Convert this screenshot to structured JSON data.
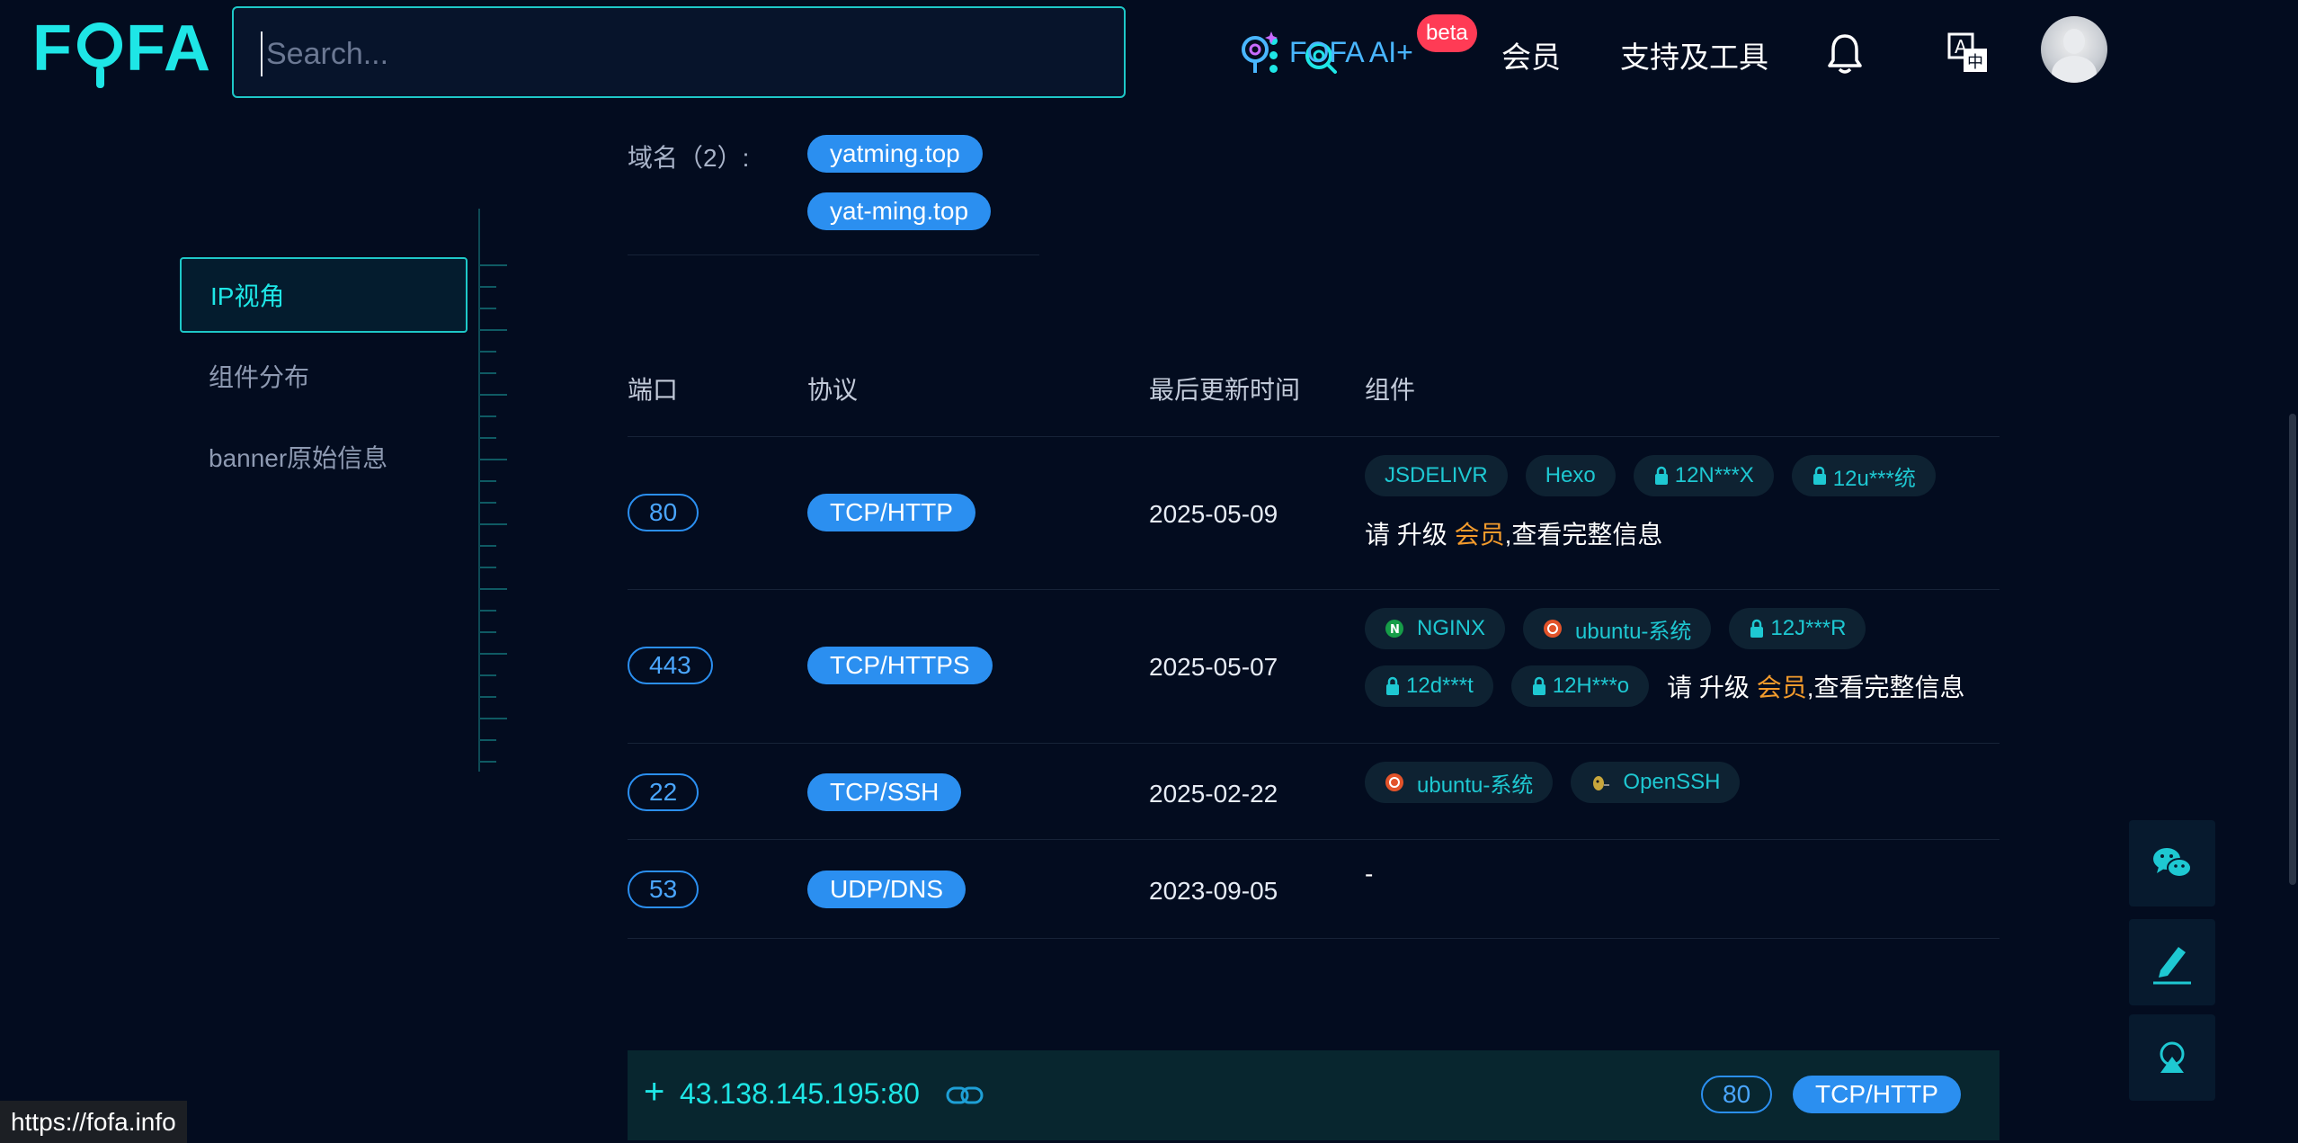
{
  "header": {
    "logo_text": "FOFA",
    "search_placeholder": "Search...",
    "ai_label": "FOFA AI+",
    "beta_label": "beta",
    "nav_member": "会员",
    "nav_tools": "支持及工具"
  },
  "sidebar": {
    "items": [
      {
        "label": "IP视角",
        "active": true
      },
      {
        "label": "组件分布",
        "active": false
      },
      {
        "label": "banner原始信息",
        "active": false
      }
    ]
  },
  "domains": {
    "label": "域名（2）:",
    "items": [
      "yatming.top",
      "yat-ming.top"
    ]
  },
  "table": {
    "headers": {
      "port": "端口",
      "protocol": "协议",
      "updated": "最后更新时间",
      "components": "组件"
    },
    "rows": [
      {
        "port": "80",
        "protocol": "TCP/HTTP",
        "updated": "2025-05-09",
        "components": [
          "JSDELIVR",
          "Hexo"
        ],
        "locked": [
          "12N***X",
          "12u***统"
        ],
        "upgrade": {
          "pre": "请 升级 ",
          "vip": "会员",
          "post": ",查看完整信息"
        }
      },
      {
        "port": "443",
        "protocol": "TCP/HTTPS",
        "updated": "2025-05-07",
        "components": [
          "NGINX",
          "ubuntu-系统"
        ],
        "locked": [
          "12J***R",
          "12d***t",
          "12H***o"
        ],
        "upgrade": {
          "pre": "请 升级 ",
          "vip": "会员",
          "post": ",查看完整信息"
        }
      },
      {
        "port": "22",
        "protocol": "TCP/SSH",
        "updated": "2025-02-22",
        "components": [
          "ubuntu-系统",
          "OpenSSH"
        ]
      },
      {
        "port": "53",
        "protocol": "UDP/DNS",
        "updated": "2023-09-05",
        "empty_mark": "-"
      }
    ]
  },
  "host_bar": {
    "plus": "+",
    "host": "43.138.145.195:80",
    "port": "80",
    "protocol": "TCP/HTTP"
  },
  "status_bar": {
    "url": "https://fofa.info"
  },
  "colors": {
    "background": "#030c1f",
    "accent_cyan": "#1ee6e6",
    "pill_blue": "#2b8ff0",
    "beta_red": "#ff3b55",
    "vip_orange": "#f39b2c"
  },
  "icons": {
    "search": "search-icon",
    "ai": "fofa-ai-icon",
    "bell": "bell-icon",
    "language": "translate-icon",
    "wechat": "wechat-icon",
    "feedback": "pen-icon",
    "top": "map-pin-icon",
    "link": "link-icon"
  }
}
